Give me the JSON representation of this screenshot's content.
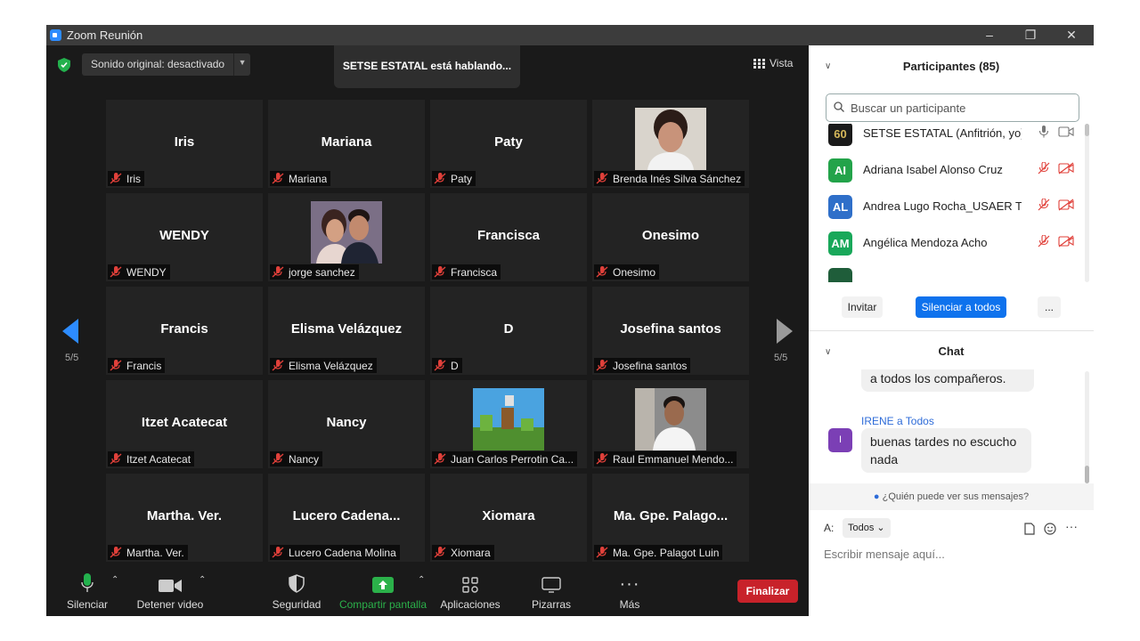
{
  "window": {
    "title": "Zoom Reunión"
  },
  "stage": {
    "sound_label": "Sonido original: desactivado",
    "speaking": "SETSE ESTATAL está hablando...",
    "view_label": "Vista",
    "page_left": "5/5",
    "page_right": "5/5"
  },
  "tiles": [
    {
      "name": "Iris",
      "label": "Iris"
    },
    {
      "name": "Mariana",
      "label": "Mariana"
    },
    {
      "name": "Paty",
      "label": "Paty"
    },
    {
      "name": "",
      "label": "Brenda Inés Silva Sánchez",
      "photo": "woman"
    },
    {
      "name": "WENDY",
      "label": "WENDY"
    },
    {
      "name": "",
      "label": "jorge sanchez",
      "photo": "couple"
    },
    {
      "name": "Francisca",
      "label": "Francisca"
    },
    {
      "name": "Onesimo",
      "label": "Onesimo"
    },
    {
      "name": "Francis",
      "label": "Francis"
    },
    {
      "name": "Elisma Velázquez",
      "label": "Elisma Velázquez"
    },
    {
      "name": "D",
      "label": "D"
    },
    {
      "name": "Josefina santos",
      "label": "Josefina santos"
    },
    {
      "name": "Itzet Acatecat",
      "label": "Itzet Acatecat"
    },
    {
      "name": "Nancy",
      "label": "Nancy"
    },
    {
      "name": "",
      "label": "Juan Carlos Perrotin Ca...",
      "photo": "game"
    },
    {
      "name": "",
      "label": "Raul Emmanuel Mendo...",
      "photo": "man"
    },
    {
      "name": "Martha.  Ver.",
      "label": "Martha.  Ver."
    },
    {
      "name": "Lucero  Cadena...",
      "label": "Lucero Cadena Molina"
    },
    {
      "name": "Xiomara",
      "label": "Xiomara"
    },
    {
      "name": "Ma. Gpe. Palago...",
      "label": "Ma. Gpe. Palagot Luin"
    }
  ],
  "toolbar": {
    "mute": "Silenciar",
    "video": "Detener video",
    "security": "Seguridad",
    "share": "Compartir pantalla",
    "apps": "Aplicaciones",
    "whiteboards": "Pizarras",
    "more": "Más",
    "end": "Finalizar"
  },
  "participants": {
    "title": "Participantes (85)",
    "search_placeholder": "Buscar un participante",
    "list": [
      {
        "initials": "60",
        "name": "SETSE ESTATAL (Anfitrión, yo)",
        "color": "#1a1a1a",
        "muted": false
      },
      {
        "initials": "AI",
        "name": "Adriana Isabel Alonso Cruz",
        "color": "#23a34a",
        "muted": true
      },
      {
        "initials": "AL",
        "name": "Andrea Lugo Rocha_USAER T",
        "color": "#2f6fc9",
        "muted": true
      },
      {
        "initials": "AM",
        "name": "Angélica Mendoza Acho",
        "color": "#19a85a",
        "muted": true
      }
    ],
    "invite": "Invitar",
    "mute_all": "Silenciar a todos",
    "more": "..."
  },
  "chat": {
    "title": "Chat",
    "prev_message": "a todos los compañeros.",
    "sender": "IRENE a Todos",
    "sender_initial": "I",
    "message": "buenas tardes no escucho nada",
    "who_can_see": "¿Quién puede ver sus mensajes?",
    "to_label": "A:",
    "recipient": "Todos",
    "input_placeholder": "Escribir mensaje aquí..."
  },
  "colors": {
    "accent": "#0e72ed",
    "share_green": "#2bb14a",
    "end_red": "#c8222a",
    "mute_red": "#e0403a"
  }
}
